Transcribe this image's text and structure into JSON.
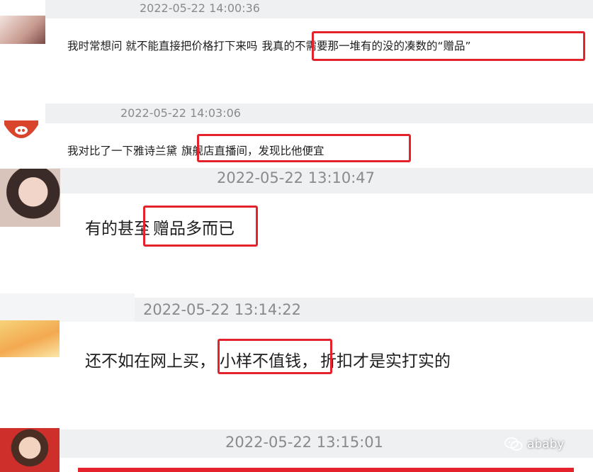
{
  "comments": [
    {
      "timestamp": "2022-05-22 14:00:36",
      "text_plain": "我时常想问 就不能直接把价格打下来吗",
      "text_highlight": "我真的不需要那一堆有的没的凑数的“赠品”"
    },
    {
      "timestamp": "2022-05-22 14:03:06",
      "text_plain": "我对比了一下雅诗兰黛",
      "text_highlight": "旗舰店直播间，发现比他便宜"
    },
    {
      "timestamp": "2022-05-22 13:10:47",
      "text_plain": "有的甚至",
      "text_highlight": "赠品多而已"
    },
    {
      "timestamp": "2022-05-22 13:14:22",
      "text_plain_1": "还不如在网上买，",
      "text_highlight": "小样不值钱，",
      "text_plain_2": "折扣才是实打实的"
    },
    {
      "timestamp": "2022-05-22 13:15:01"
    }
  ],
  "watermark": {
    "label": "ababy",
    "icon": "wechat-icon"
  },
  "colors": {
    "highlight": "#e4222b",
    "band": "#eef0f2",
    "timestamp": "#8a8a8a"
  }
}
